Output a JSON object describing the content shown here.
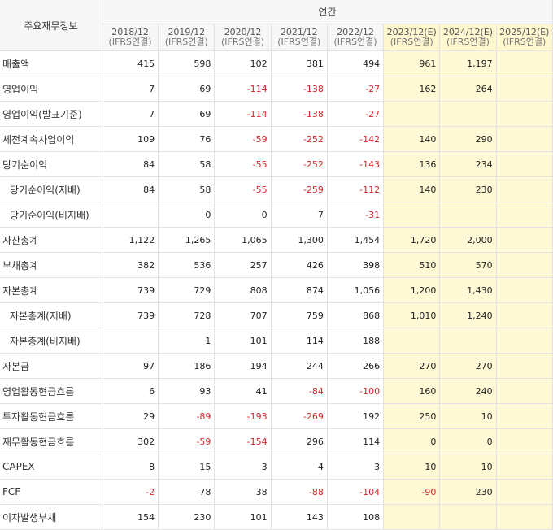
{
  "header": {
    "corner_label": "주요재무정보",
    "annual_label": "연간",
    "periods": [
      {
        "year": "2018/12",
        "basis": "(IFRS연결)",
        "estimate": false
      },
      {
        "year": "2019/12",
        "basis": "(IFRS연결)",
        "estimate": false
      },
      {
        "year": "2020/12",
        "basis": "(IFRS연결)",
        "estimate": false
      },
      {
        "year": "2021/12",
        "basis": "(IFRS연결)",
        "estimate": false
      },
      {
        "year": "2022/12",
        "basis": "(IFRS연결)",
        "estimate": false
      },
      {
        "year": "2023/12(E)",
        "basis": "(IFRS연결)",
        "estimate": true
      },
      {
        "year": "2024/12(E)",
        "basis": "(IFRS연결)",
        "estimate": true
      },
      {
        "year": "2025/12(E)",
        "basis": "(IFRS연결)",
        "estimate": true
      }
    ]
  },
  "rows": [
    {
      "label": "매출액",
      "sub": false,
      "values": [
        "415",
        "598",
        "102",
        "381",
        "494",
        "961",
        "1,197",
        ""
      ]
    },
    {
      "label": "영업이익",
      "sub": false,
      "values": [
        "7",
        "69",
        "-114",
        "-138",
        "-27",
        "162",
        "264",
        ""
      ]
    },
    {
      "label": "영업이익(발표기준)",
      "sub": false,
      "values": [
        "7",
        "69",
        "-114",
        "-138",
        "-27",
        "",
        "",
        ""
      ]
    },
    {
      "label": "세전계속사업이익",
      "sub": false,
      "values": [
        "109",
        "76",
        "-59",
        "-252",
        "-142",
        "140",
        "290",
        ""
      ]
    },
    {
      "label": "당기순이익",
      "sub": false,
      "values": [
        "84",
        "58",
        "-55",
        "-252",
        "-143",
        "136",
        "234",
        ""
      ]
    },
    {
      "label": "당기순이익(지배)",
      "sub": true,
      "values": [
        "84",
        "58",
        "-55",
        "-259",
        "-112",
        "140",
        "230",
        ""
      ]
    },
    {
      "label": "당기순이익(비지배)",
      "sub": true,
      "values": [
        "",
        "0",
        "0",
        "7",
        "-31",
        "",
        "",
        ""
      ]
    },
    {
      "label": "자산총계",
      "sub": false,
      "values": [
        "1,122",
        "1,265",
        "1,065",
        "1,300",
        "1,454",
        "1,720",
        "2,000",
        ""
      ]
    },
    {
      "label": "부채총계",
      "sub": false,
      "values": [
        "382",
        "536",
        "257",
        "426",
        "398",
        "510",
        "570",
        ""
      ]
    },
    {
      "label": "자본총계",
      "sub": false,
      "values": [
        "739",
        "729",
        "808",
        "874",
        "1,056",
        "1,200",
        "1,430",
        ""
      ]
    },
    {
      "label": "자본총계(지배)",
      "sub": true,
      "values": [
        "739",
        "728",
        "707",
        "759",
        "868",
        "1,010",
        "1,240",
        ""
      ]
    },
    {
      "label": "자본총계(비지배)",
      "sub": true,
      "values": [
        "",
        "1",
        "101",
        "114",
        "188",
        "",
        "",
        ""
      ]
    },
    {
      "label": "자본금",
      "sub": false,
      "values": [
        "97",
        "186",
        "194",
        "244",
        "266",
        "270",
        "270",
        ""
      ]
    },
    {
      "label": "영업활동현금흐름",
      "sub": false,
      "values": [
        "6",
        "93",
        "41",
        "-84",
        "-100",
        "160",
        "240",
        ""
      ]
    },
    {
      "label": "투자활동현금흐름",
      "sub": false,
      "values": [
        "29",
        "-89",
        "-193",
        "-269",
        "192",
        "250",
        "10",
        ""
      ]
    },
    {
      "label": "재무활동현금흐름",
      "sub": false,
      "values": [
        "302",
        "-59",
        "-154",
        "296",
        "114",
        "0",
        "0",
        ""
      ]
    },
    {
      "label": "CAPEX",
      "sub": false,
      "values": [
        "8",
        "15",
        "3",
        "4",
        "3",
        "10",
        "10",
        ""
      ]
    },
    {
      "label": "FCF",
      "sub": false,
      "values": [
        "-2",
        "78",
        "38",
        "-88",
        "-104",
        "-90",
        "230",
        ""
      ]
    },
    {
      "label": "이자발생부채",
      "sub": false,
      "values": [
        "154",
        "230",
        "101",
        "143",
        "108",
        "",
        "",
        ""
      ]
    }
  ],
  "colors": {
    "negative": "#d4262b",
    "estimate_bg": "#fff9d6",
    "header_bg": "#f7f7f7"
  }
}
